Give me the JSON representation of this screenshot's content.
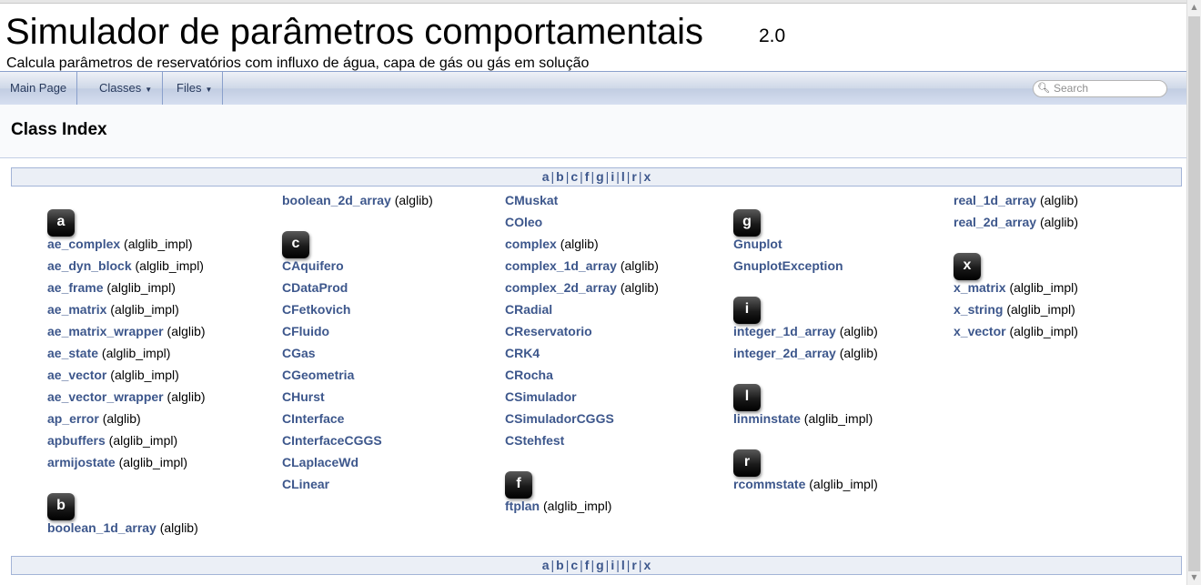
{
  "project": {
    "name": "Simulador de parâmetros comportamentais",
    "number": "2.0",
    "brief": "Calcula parâmetros de reservatórios com influxo de água, capa de gás ou gás em solução"
  },
  "nav": {
    "main_page": "Main Page",
    "classes": "Classes",
    "files": "Files",
    "search_placeholder": "Search"
  },
  "page_title": "Class Index",
  "qindex_letters": [
    "a",
    "b",
    "c",
    "f",
    "g",
    "i",
    "l",
    "r",
    "x"
  ],
  "columns": [
    [
      {
        "letter": "a"
      },
      {
        "name": "ae_complex",
        "ns": "(alglib_impl)"
      },
      {
        "name": "ae_dyn_block",
        "ns": "(alglib_impl)"
      },
      {
        "name": "ae_frame",
        "ns": "(alglib_impl)"
      },
      {
        "name": "ae_matrix",
        "ns": "(alglib_impl)"
      },
      {
        "name": "ae_matrix_wrapper",
        "ns": "(alglib)"
      },
      {
        "name": "ae_state",
        "ns": "(alglib_impl)"
      },
      {
        "name": "ae_vector",
        "ns": "(alglib_impl)"
      },
      {
        "name": "ae_vector_wrapper",
        "ns": "(alglib)"
      },
      {
        "name": "ap_error",
        "ns": "(alglib)"
      },
      {
        "name": "apbuffers",
        "ns": "(alglib_impl)"
      },
      {
        "name": "armijostate",
        "ns": "(alglib_impl)"
      },
      {
        "letter": "b"
      },
      {
        "name": "boolean_1d_array",
        "ns": "(alglib)"
      }
    ],
    [
      {
        "name": "boolean_2d_array",
        "ns": "(alglib)"
      },
      {
        "letter": "c"
      },
      {
        "name": "CAquifero",
        "ns": ""
      },
      {
        "name": "CDataProd",
        "ns": ""
      },
      {
        "name": "CFetkovich",
        "ns": ""
      },
      {
        "name": "CFluido",
        "ns": ""
      },
      {
        "name": "CGas",
        "ns": ""
      },
      {
        "name": "CGeometria",
        "ns": ""
      },
      {
        "name": "CHurst",
        "ns": ""
      },
      {
        "name": "CInterface",
        "ns": ""
      },
      {
        "name": "CInterfaceCGGS",
        "ns": ""
      },
      {
        "name": "CLaplaceWd",
        "ns": ""
      },
      {
        "name": "CLinear",
        "ns": ""
      }
    ],
    [
      {
        "name": "CMuskat",
        "ns": ""
      },
      {
        "name": "COleo",
        "ns": ""
      },
      {
        "name": "complex",
        "ns": "(alglib)"
      },
      {
        "name": "complex_1d_array",
        "ns": "(alglib)"
      },
      {
        "name": "complex_2d_array",
        "ns": "(alglib)"
      },
      {
        "name": "CRadial",
        "ns": ""
      },
      {
        "name": "CReservatorio",
        "ns": ""
      },
      {
        "name": "CRK4",
        "ns": ""
      },
      {
        "name": "CRocha",
        "ns": ""
      },
      {
        "name": "CSimulador",
        "ns": ""
      },
      {
        "name": "CSimuladorCGGS",
        "ns": ""
      },
      {
        "name": "CStehfest",
        "ns": ""
      },
      {
        "letter": "f"
      },
      {
        "name": "ftplan",
        "ns": "(alglib_impl)"
      }
    ],
    [
      {
        "letter": "g"
      },
      {
        "name": "Gnuplot",
        "ns": ""
      },
      {
        "name": "GnuplotException",
        "ns": ""
      },
      {
        "letter": "i"
      },
      {
        "name": "integer_1d_array",
        "ns": "(alglib)"
      },
      {
        "name": "integer_2d_array",
        "ns": "(alglib)"
      },
      {
        "letter": "l"
      },
      {
        "name": "linminstate",
        "ns": "(alglib_impl)"
      },
      {
        "letter": "r"
      },
      {
        "name": "rcommstate",
        "ns": "(alglib_impl)"
      }
    ],
    [
      {
        "name": "real_1d_array",
        "ns": "(alglib)"
      },
      {
        "name": "real_2d_array",
        "ns": "(alglib)"
      },
      {
        "letter": "x"
      },
      {
        "name": "x_matrix",
        "ns": "(alglib_impl)"
      },
      {
        "name": "x_string",
        "ns": "(alglib_impl)"
      },
      {
        "name": "x_vector",
        "ns": "(alglib_impl)"
      }
    ]
  ]
}
